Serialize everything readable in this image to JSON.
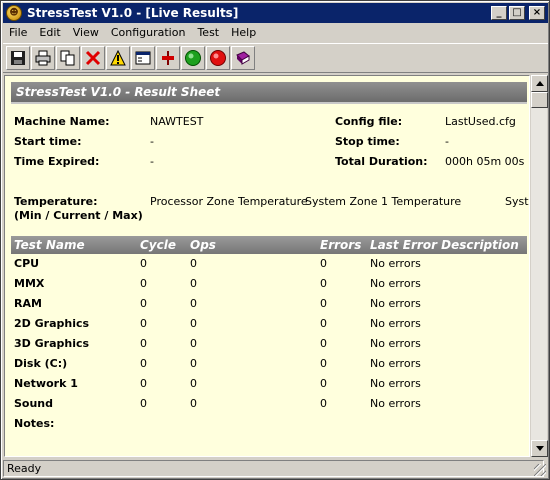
{
  "window": {
    "title": "StressTest V1.0 - [Live Results]",
    "minimize": "_",
    "maximize": "□",
    "close": "×"
  },
  "menu": [
    "File",
    "Edit",
    "View",
    "Configuration",
    "Test",
    "Help"
  ],
  "toolbar_icons": [
    "save-icon",
    "print-icon",
    "copy-icon",
    "delete-icon",
    "warning-icon",
    "window-icon",
    "cpu-test-icon",
    "start-green-icon",
    "stop-red-icon",
    "book-icon"
  ],
  "sheet": {
    "title": "StressTest V1.0 - Result Sheet",
    "machine_name_label": "Machine Name:",
    "machine_name": "NAWTEST",
    "config_file_label": "Config file:",
    "config_file": "LastUsed.cfg",
    "start_time_label": "Start time:",
    "start_time": "-",
    "stop_time_label": "Stop time:",
    "stop_time": "-",
    "time_expired_label": "Time Expired:",
    "time_expired": "-",
    "total_duration_label": "Total Duration:",
    "total_duration": "000h 05m 00s",
    "temperature_label": "Temperature:",
    "temperature_sub": "(Min / Current / Max)",
    "temperature_zones": [
      "Processor Zone Temperature",
      "System Zone 1 Temperature",
      "Syste"
    ]
  },
  "table": {
    "headers": [
      "Test Name",
      "Cycle",
      "Ops",
      "Errors",
      "Last Error Description"
    ],
    "rows": [
      {
        "name": "CPU",
        "cycle": "0",
        "ops": "0",
        "errors": "0",
        "last": "No errors"
      },
      {
        "name": "MMX",
        "cycle": "0",
        "ops": "0",
        "errors": "0",
        "last": "No errors"
      },
      {
        "name": "RAM",
        "cycle": "0",
        "ops": "0",
        "errors": "0",
        "last": "No errors"
      },
      {
        "name": "2D Graphics",
        "cycle": "0",
        "ops": "0",
        "errors": "0",
        "last": "No errors"
      },
      {
        "name": "3D Graphics",
        "cycle": "0",
        "ops": "0",
        "errors": "0",
        "last": "No errors"
      },
      {
        "name": "Disk (C:)",
        "cycle": "0",
        "ops": "0",
        "errors": "0",
        "last": "No errors"
      },
      {
        "name": "Network 1",
        "cycle": "0",
        "ops": "0",
        "errors": "0",
        "last": "No errors"
      },
      {
        "name": "Sound",
        "cycle": "0",
        "ops": "0",
        "errors": "0",
        "last": "No errors"
      }
    ],
    "notes_label": "Notes:"
  },
  "status": {
    "text": "Ready"
  }
}
